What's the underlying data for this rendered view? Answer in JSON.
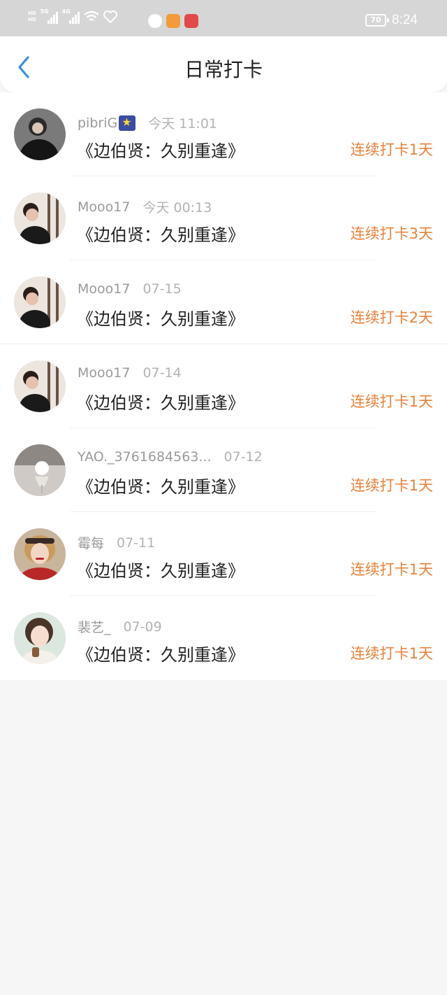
{
  "status_bar": {
    "clock": "8:24",
    "battery": "70",
    "net1": "5G",
    "net2": "4G",
    "hd_top": "HD",
    "hd_bottom": "HD",
    "icons": [
      "signal-icon",
      "wifi-icon",
      "heart-icon",
      "app-icon-1",
      "app-icon-2",
      "app-icon-3"
    ]
  },
  "header": {
    "title": "日常打卡",
    "back_icon": "chevron-left-icon",
    "accent": "#3b8de0"
  },
  "colors": {
    "streak": "#e8823a",
    "username": "#9a9a9a",
    "time": "#b3b3b3"
  },
  "entries": [
    {
      "username": "pibriG",
      "has_emoji": true,
      "time": "今天 11:01",
      "title": "《边伯贤：久别重逢》",
      "streak": "连续打卡1天"
    },
    {
      "username": "Mooo17",
      "time": "今天 00:13",
      "title": "《边伯贤：久别重逢》",
      "streak": "连续打卡3天"
    },
    {
      "username": "Mooo17",
      "time": "07-15",
      "title": "《边伯贤：久别重逢》",
      "streak": "连续打卡2天"
    },
    {
      "username": "Mooo17",
      "time": "07-14",
      "title": "《边伯贤：久别重逢》",
      "streak": "连续打卡1天"
    },
    {
      "username": "YAO._3761684563...",
      "time": "07-12",
      "title": "《边伯贤：久别重逢》",
      "streak": "连续打卡1天"
    },
    {
      "username": "霉每",
      "time": "07-11",
      "title": "《边伯贤：久别重逢》",
      "streak": "连续打卡1天"
    },
    {
      "username": "裴艺_",
      "time": "07-09",
      "title": "《边伯贤：久别重逢》",
      "streak": "连续打卡1天"
    }
  ]
}
